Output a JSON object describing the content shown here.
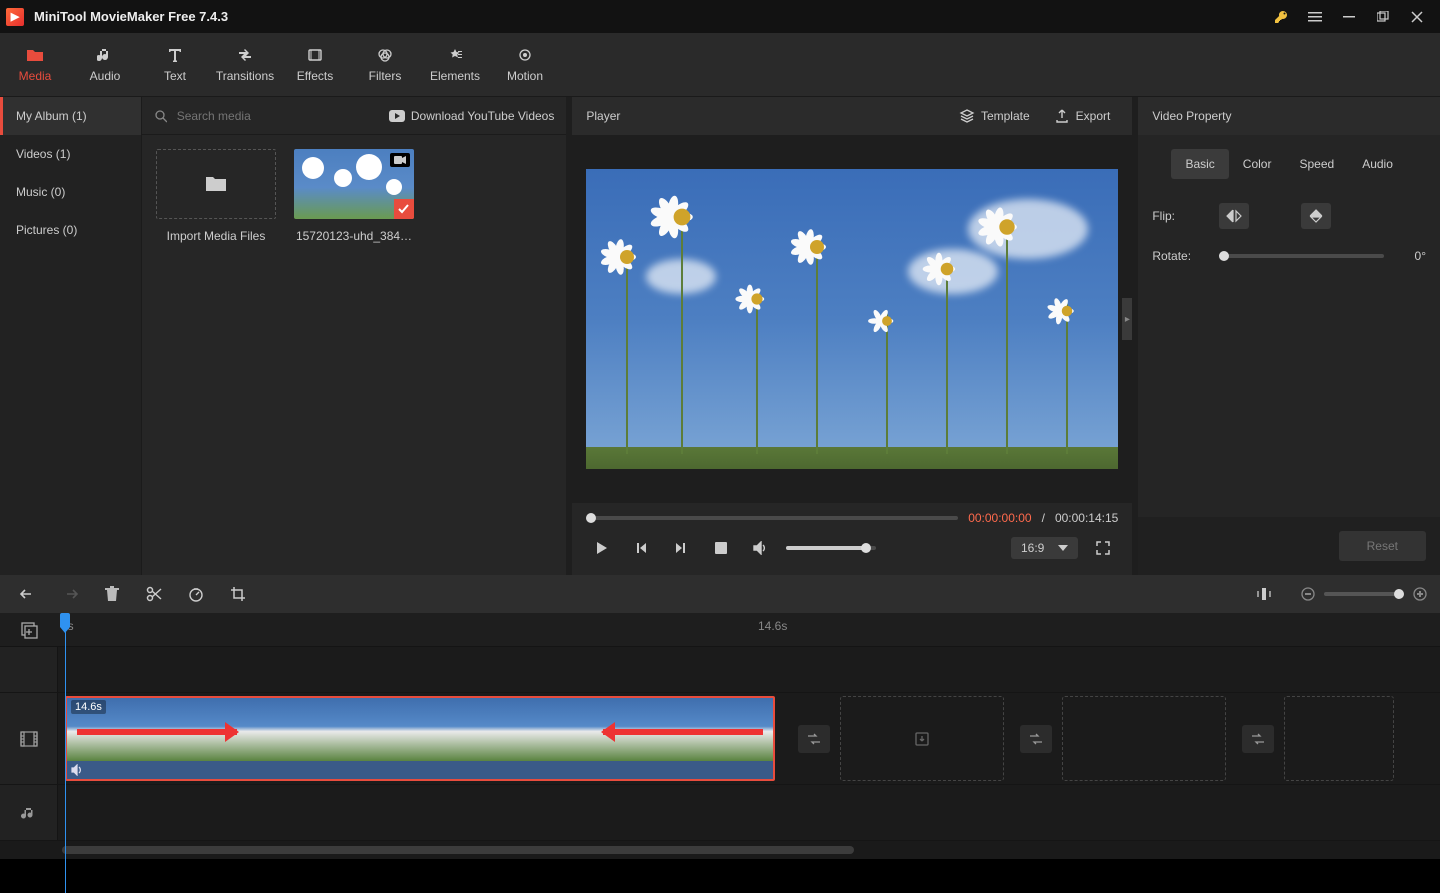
{
  "title": "MiniTool MovieMaker Free 7.4.3",
  "ribbon": {
    "media": "Media",
    "audio": "Audio",
    "text": "Text",
    "transitions": "Transitions",
    "effects": "Effects",
    "filters": "Filters",
    "elements": "Elements",
    "motion": "Motion"
  },
  "mediaNav": {
    "album": "My Album (1)",
    "videos": "Videos (1)",
    "music": "Music (0)",
    "pictures": "Pictures (0)"
  },
  "searchPlaceholder": "Search media",
  "downloadYT": "Download YouTube Videos",
  "tiles": {
    "import": "Import Media Files",
    "clip": "15720123-uhd_384…"
  },
  "player": {
    "title": "Player",
    "template": "Template",
    "export": "Export",
    "cur": "00:00:00:00",
    "sep": " / ",
    "dur": "00:00:14:15",
    "aspect": "16:9"
  },
  "props": {
    "title": "Video Property",
    "tabs": {
      "basic": "Basic",
      "color": "Color",
      "speed": "Speed",
      "audio": "Audio"
    },
    "flip": "Flip:",
    "rotate": "Rotate:",
    "rotateVal": "0°",
    "reset": "Reset"
  },
  "timeline": {
    "zero": "0s",
    "end": "14.6s",
    "clipDur": "14.6s"
  }
}
